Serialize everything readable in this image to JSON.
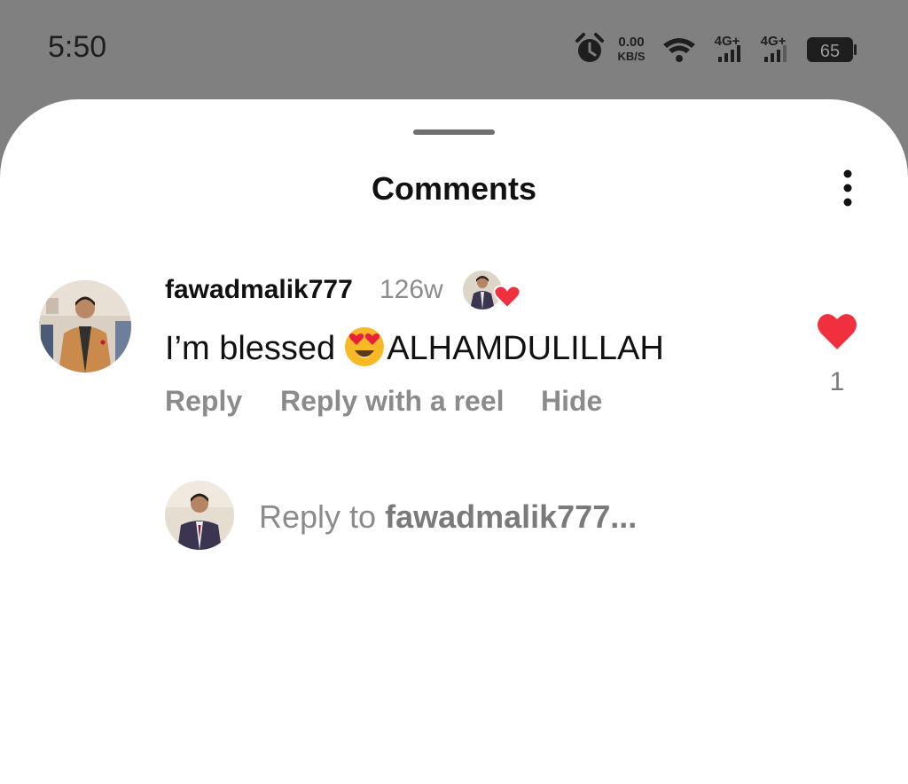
{
  "status_bar": {
    "time": "5:50",
    "net_speed_value": "0.00",
    "net_speed_unit": "KB/S",
    "sim1_label": "4G+",
    "sim2_label": "4G+",
    "battery": "65",
    "icons": [
      "alarm-icon",
      "wifi-icon",
      "signal-icon",
      "battery-icon"
    ]
  },
  "sheet": {
    "title": "Comments",
    "menu_icon": "more-vertical-icon"
  },
  "comment": {
    "username": "fawadmalik777",
    "time_ago": "126w",
    "text_before": "I’m blessed",
    "emoji": "heart-eyes-emoji",
    "text_after": "ALHAMDULILLAH",
    "actions": {
      "reply": "Reply",
      "reply_reel": "Reply with a reel",
      "hide": "Hide"
    },
    "like_icon": "heart-icon",
    "like_color": "#f0303f",
    "like_count": "1"
  },
  "reply_box": {
    "prefix": "Reply to ",
    "target": "fawadmalik777..."
  }
}
